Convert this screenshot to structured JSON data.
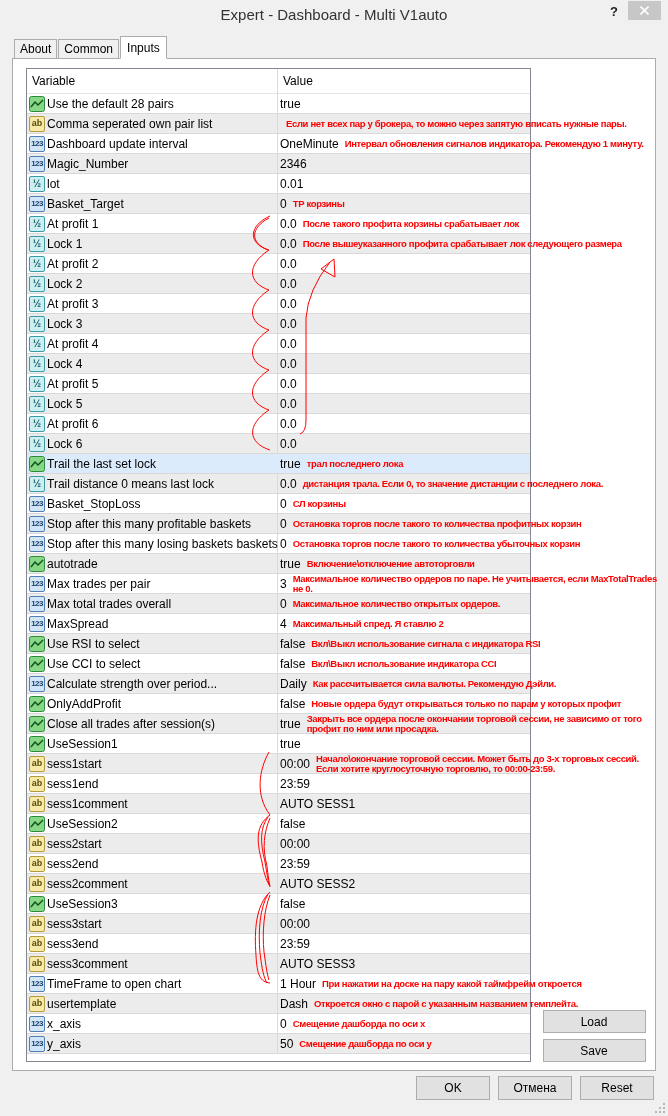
{
  "window": {
    "title": "Expert - Dashboard - Multi V1auto",
    "help": "?"
  },
  "tabs": [
    {
      "label": "About",
      "selected": false
    },
    {
      "label": "Common",
      "selected": false
    },
    {
      "label": "Inputs",
      "selected": true
    }
  ],
  "table": {
    "columns": [
      "Variable",
      "Value"
    ],
    "rows": [
      {
        "kind": "bool",
        "variable": "Use the default 28 pairs",
        "value": "true",
        "selected": false
      },
      {
        "kind": "string",
        "icon": "ab",
        "variable": "Comma seperated own pair list",
        "selected": false,
        "note": "Если нет всех пар у брокера, то можно через запятую вписать нужные пары."
      },
      {
        "kind": "int",
        "icon": "123",
        "variable": "Dashboard update interval",
        "value": "OneMinute",
        "selected": false,
        "note": "Интервал обновления сигналов индикатора. Рекомендую 1 минуту."
      },
      {
        "kind": "int",
        "icon": "123",
        "variable": "Magic_Number",
        "value": "2346",
        "selected": false
      },
      {
        "kind": "double",
        "icon": "½",
        "variable": "lot",
        "value": "0.01",
        "selected": false
      },
      {
        "kind": "int",
        "icon": "123",
        "variable": "Basket_Target",
        "value": "0",
        "selected": false,
        "note": "ТР корзины"
      },
      {
        "kind": "double",
        "icon": "½",
        "variable": "At profit 1",
        "value": "0.0",
        "selected": false,
        "note": "После такого профита корзины срабатывает лок"
      },
      {
        "kind": "double",
        "icon": "½",
        "variable": "Lock 1",
        "value": "0.0",
        "selected": false,
        "note": "После вышеуказанного профита срабатывает лок следующего размера"
      },
      {
        "kind": "double",
        "icon": "½",
        "variable": "At profit 2",
        "value": "0.0",
        "selected": false
      },
      {
        "kind": "double",
        "icon": "½",
        "variable": "Lock 2",
        "value": "0.0",
        "selected": false
      },
      {
        "kind": "double",
        "icon": "½",
        "variable": "At profit 3",
        "value": "0.0",
        "selected": false
      },
      {
        "kind": "double",
        "icon": "½",
        "variable": "Lock 3",
        "value": "0.0",
        "selected": false
      },
      {
        "kind": "double",
        "icon": "½",
        "variable": "At profit 4",
        "value": "0.0",
        "selected": false
      },
      {
        "kind": "double",
        "icon": "½",
        "variable": "Lock 4",
        "value": "0.0",
        "selected": false
      },
      {
        "kind": "double",
        "icon": "½",
        "variable": "At profit 5",
        "value": "0.0",
        "selected": false
      },
      {
        "kind": "double",
        "icon": "½",
        "variable": "Lock 5",
        "value": "0.0",
        "selected": false
      },
      {
        "kind": "double",
        "icon": "½",
        "variable": "At profit 6",
        "value": "0.0",
        "selected": false
      },
      {
        "kind": "double",
        "icon": "½",
        "variable": "Lock 6",
        "value": "0.0",
        "selected": false
      },
      {
        "kind": "bool",
        "variable": "Trail the last set lock",
        "value": "true",
        "selected": true,
        "note": "трал последнего лока"
      },
      {
        "kind": "double",
        "icon": "½",
        "variable": "Trail distance 0 means last lock",
        "value": "0.0",
        "selected": false,
        "note": "дистанция трала. Если 0, то значение дистанции с последнего лока."
      },
      {
        "kind": "int",
        "icon": "123",
        "variable": "Basket_StopLoss",
        "value": "0",
        "selected": false,
        "note": "СЛ корзины"
      },
      {
        "kind": "int",
        "icon": "123",
        "variable": "Stop after this many profitable baskets",
        "value": "0",
        "selected": false,
        "note": "Остановка торгов после такого то количества профитных корзин"
      },
      {
        "kind": "int",
        "icon": "123",
        "variable": "Stop after this many losing baskets baskets",
        "value": "0",
        "selected": false,
        "note": "Остановка торгов после такого то количества убыточных корзин"
      },
      {
        "kind": "bool",
        "variable": "autotrade",
        "value": "true",
        "selected": false,
        "note": "Включение\\отключение автоторговли"
      },
      {
        "kind": "int",
        "icon": "123",
        "variable": "Max trades per pair",
        "value": "3",
        "selected": false,
        "note": "Максимальное количество ордеров по паре. Не учитывается, если MaxTotalTrades не 0."
      },
      {
        "kind": "int",
        "icon": "123",
        "variable": "Max total trades overall",
        "value": "0",
        "selected": false,
        "note": "Максимальное количество открытых ордеров."
      },
      {
        "kind": "int",
        "icon": "123",
        "variable": "MaxSpread",
        "value": "4",
        "selected": false,
        "note": "Максимальный спред. Я ставлю 2"
      },
      {
        "kind": "bool",
        "variable": "Use RSI to select",
        "value": "false",
        "selected": false,
        "note": "Вкл\\Выкл использование сигнала с индикатора RSI"
      },
      {
        "kind": "bool",
        "variable": "Use CCI to select",
        "value": "false",
        "selected": false,
        "note": "Вкл\\Выкл использование индикатора CCI"
      },
      {
        "kind": "int",
        "icon": "123",
        "variable": "Calculate strength over period...",
        "value": "Daily",
        "selected": false,
        "note": "Как рассчитывается сила валюты. Рекомендую Дэйли."
      },
      {
        "kind": "bool",
        "variable": "OnlyAddProfit",
        "value": "false",
        "selected": false,
        "note": "Новые ордера будут открываться только по парам у которых профит"
      },
      {
        "kind": "bool",
        "variable": "Close all trades after session(s)",
        "value": "true",
        "selected": false,
        "note": "Закрыть все ордера после окончании торговой сессии, не зависимо от того профит по ним или просадка."
      },
      {
        "kind": "bool",
        "variable": "UseSession1",
        "value": "true",
        "selected": false
      },
      {
        "kind": "string",
        "icon": "ab",
        "variable": "sess1start",
        "value": "00:00",
        "selected": false,
        "note": "Начало\\окончание торговой сессии. Может быть до 3-х торговых сессий. Если хотите круглосуточную торговлю, то 00:00-23:59."
      },
      {
        "kind": "string",
        "icon": "ab",
        "variable": "sess1end",
        "value": "23:59",
        "selected": false
      },
      {
        "kind": "string",
        "icon": "ab",
        "variable": "sess1comment",
        "value": "AUTO SESS1",
        "selected": false
      },
      {
        "kind": "bool",
        "variable": "UseSession2",
        "value": "false",
        "selected": false
      },
      {
        "kind": "string",
        "icon": "ab",
        "variable": "sess2start",
        "value": "00:00",
        "selected": false
      },
      {
        "kind": "string",
        "icon": "ab",
        "variable": "sess2end",
        "value": "23:59",
        "selected": false
      },
      {
        "kind": "string",
        "icon": "ab",
        "variable": "sess2comment",
        "value": "AUTO SESS2",
        "selected": false
      },
      {
        "kind": "bool",
        "variable": "UseSession3",
        "value": "false",
        "selected": false
      },
      {
        "kind": "string",
        "icon": "ab",
        "variable": "sess3start",
        "value": "00:00",
        "selected": false
      },
      {
        "kind": "string",
        "icon": "ab",
        "variable": "sess3end",
        "value": "23:59",
        "selected": false
      },
      {
        "kind": "string",
        "icon": "ab",
        "variable": "sess3comment",
        "value": "AUTO SESS3",
        "selected": false
      },
      {
        "kind": "int",
        "icon": "123",
        "variable": "TimeFrame to open chart",
        "value": "1 Hour",
        "selected": false,
        "note": "При нажатии на доске на пару какой таймфрейм откроется"
      },
      {
        "kind": "string",
        "icon": "ab",
        "variable": "usertemplate",
        "value": "Dash",
        "selected": false,
        "note": "Откроется окно с парой с указанным названием темплейта."
      },
      {
        "kind": "int",
        "icon": "123",
        "variable": "x_axis",
        "value": "0",
        "selected": false,
        "note": "Смещение дашборда по оси х"
      },
      {
        "kind": "int",
        "icon": "123",
        "variable": "y_axis",
        "value": "50",
        "selected": false,
        "note": "Смещение дашборда по оси у"
      }
    ]
  },
  "side_buttons": [
    "Load",
    "Save"
  ],
  "buttons": [
    "OK",
    "Отмена",
    "Reset"
  ]
}
